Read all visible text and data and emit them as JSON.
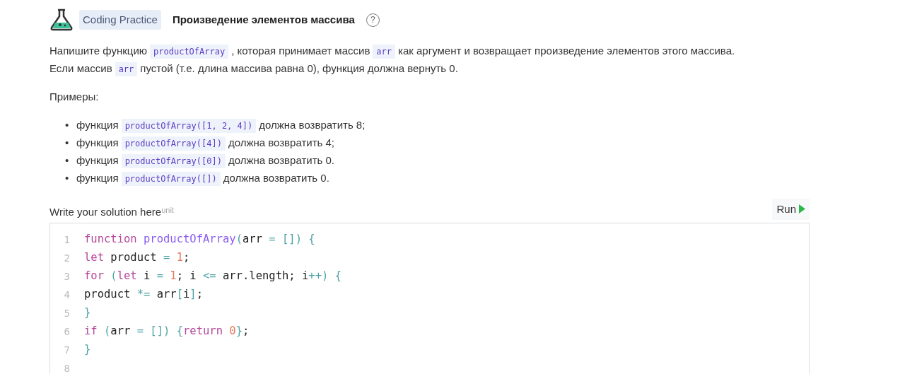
{
  "header": {
    "tag": "Coding Practice",
    "title": "Произведение элементов массива",
    "help": "?"
  },
  "description": [
    [
      {
        "kind": "text",
        "text": "Напишите функцию"
      },
      {
        "kind": "code",
        "text": "productOfArray"
      },
      {
        "kind": "text",
        "text": ", которая принимает массив"
      },
      {
        "kind": "code",
        "text": "arr"
      },
      {
        "kind": "text",
        "text": "как аргумент и возвращает произведение элементов этого массива."
      }
    ],
    [
      {
        "kind": "text",
        "text": "Если массив"
      },
      {
        "kind": "code",
        "text": "arr"
      },
      {
        "kind": "text",
        "text": "пустой (т.е. длина массива равна 0), функция должна вернуть 0."
      }
    ]
  ],
  "examples_label": "Примеры:",
  "examples": [
    [
      {
        "kind": "bullet",
        "text": "•"
      },
      {
        "kind": "text",
        "text": "функция"
      },
      {
        "kind": "code",
        "text": "productOfArray([1, 2, 4])"
      },
      {
        "kind": "text",
        "text": "должна возвратить 8;"
      }
    ],
    [
      {
        "kind": "bullet",
        "text": "•"
      },
      {
        "kind": "text",
        "text": "функция"
      },
      {
        "kind": "code",
        "text": "productOfArray([4])"
      },
      {
        "kind": "text",
        "text": "должна возвратить 4;"
      }
    ],
    [
      {
        "kind": "bullet",
        "text": "•"
      },
      {
        "kind": "text",
        "text": "функция"
      },
      {
        "kind": "code",
        "text": "productOfArray([0])"
      },
      {
        "kind": "text",
        "text": "должна возвратить 0."
      }
    ],
    [
      {
        "kind": "bullet",
        "text": "•"
      },
      {
        "kind": "text",
        "text": "функция"
      },
      {
        "kind": "code",
        "text": "productOfArray([])"
      },
      {
        "kind": "text",
        "text": "должна возвратить 0."
      }
    ]
  ],
  "solution": {
    "label": "Write your solution here",
    "ghost_text": "unit",
    "run_button": "Run"
  },
  "editor": {
    "lines": [
      {
        "number": "1",
        "tokens": [
          {
            "kind": "keyword",
            "text": "function "
          },
          {
            "kind": "function",
            "text": "productOfArray"
          },
          {
            "kind": "punct",
            "text": "("
          },
          {
            "kind": "plain",
            "text": "arr "
          },
          {
            "kind": "punct",
            "text": "= []) {"
          }
        ]
      },
      {
        "number": "2",
        "tokens": [
          {
            "kind": "keyword",
            "text": "let"
          },
          {
            "kind": "plain",
            "text": " product "
          },
          {
            "kind": "punct",
            "text": "= "
          },
          {
            "kind": "number",
            "text": "1"
          },
          {
            "kind": "plain",
            "text": ";"
          }
        ]
      },
      {
        "number": "3",
        "tokens": [
          {
            "kind": "keyword",
            "text": "for "
          },
          {
            "kind": "punct",
            "text": "("
          },
          {
            "kind": "keyword",
            "text": "let"
          },
          {
            "kind": "plain",
            "text": " i "
          },
          {
            "kind": "punct",
            "text": "= "
          },
          {
            "kind": "number",
            "text": "1"
          },
          {
            "kind": "plain",
            "text": "; i "
          },
          {
            "kind": "punct",
            "text": "<="
          },
          {
            "kind": "plain",
            "text": " arr.length; i"
          },
          {
            "kind": "punct",
            "text": "++) {"
          }
        ]
      },
      {
        "number": "4",
        "tokens": [
          {
            "kind": "plain",
            "text": "product "
          },
          {
            "kind": "punct",
            "text": "*="
          },
          {
            "kind": "plain",
            "text": " arr"
          },
          {
            "kind": "punct",
            "text": "["
          },
          {
            "kind": "plain",
            "text": "i"
          },
          {
            "kind": "punct",
            "text": "]"
          },
          {
            "kind": "plain",
            "text": ";"
          }
        ]
      },
      {
        "number": "5",
        "tokens": [
          {
            "kind": "punct",
            "text": "}"
          }
        ]
      },
      {
        "number": "6",
        "tokens": [
          {
            "kind": "keyword",
            "text": "if "
          },
          {
            "kind": "punct",
            "text": "("
          },
          {
            "kind": "plain",
            "text": "arr "
          },
          {
            "kind": "punct",
            "text": "= []) {"
          },
          {
            "kind": "keyword",
            "text": "return "
          },
          {
            "kind": "number",
            "text": "0"
          },
          {
            "kind": "punct",
            "text": "}"
          },
          {
            "kind": "plain",
            "text": ";"
          }
        ]
      },
      {
        "number": "7",
        "tokens": [
          {
            "kind": "punct",
            "text": "}"
          }
        ]
      },
      {
        "number": "8"
      }
    ]
  }
}
